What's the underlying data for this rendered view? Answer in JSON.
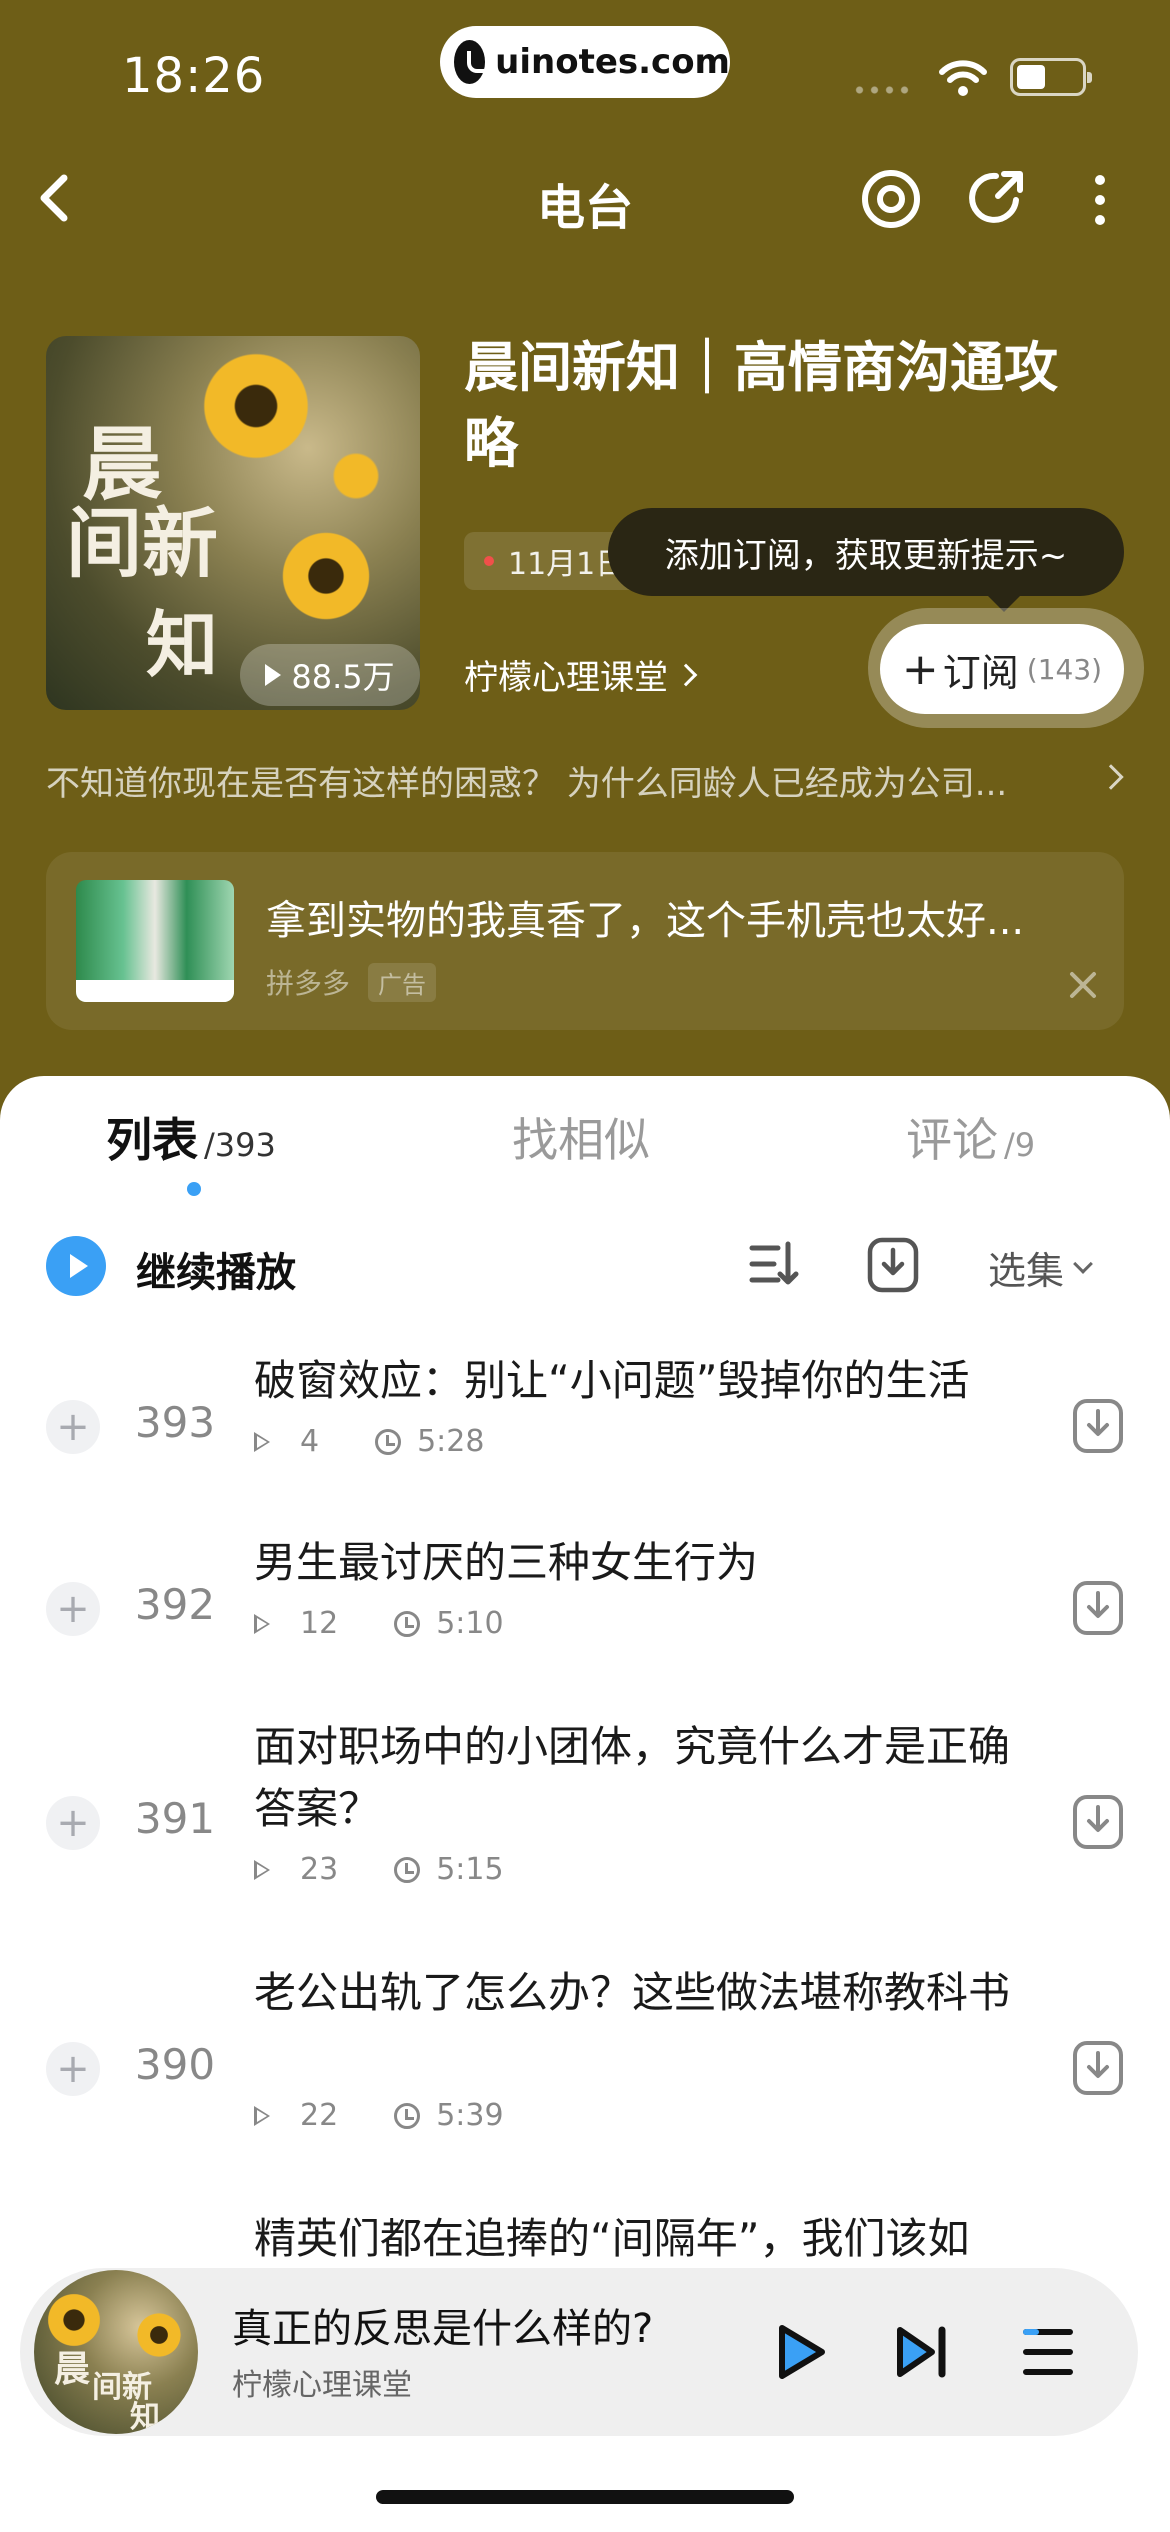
{
  "status_bar": {
    "time": "18:26",
    "url": "uinotes.com"
  },
  "nav": {
    "title": "电台"
  },
  "album": {
    "cover_lines": [
      "晨",
      "间新",
      "知"
    ],
    "plays": "88.5万",
    "title": "晨间新知｜高情商沟通攻略",
    "update": "11月1日更新",
    "tooltip": "添加订阅，获取更新提示~",
    "author": "柠檬心理课堂",
    "subscribe_label": "订阅",
    "subscribe_count": "(143)",
    "description": "不知道你现在是否有这样的困惑？ 为什么同龄人已经成为公司..."
  },
  "ad": {
    "text": "拿到实物的我真香了，这个手机壳也太好...",
    "source": "拼多多",
    "tag": "广告"
  },
  "tabs": [
    {
      "label": "列表",
      "count": "/393"
    },
    {
      "label": "找相似",
      "count": ""
    },
    {
      "label": "评论",
      "count": "/9"
    }
  ],
  "toolbar": {
    "continue_label": "继续播放",
    "select_label": "选集"
  },
  "episodes": [
    {
      "num": "393",
      "title": "破窗效应：别让“小问题”毁掉你的生活",
      "plays": "4",
      "duration": "5:28"
    },
    {
      "num": "392",
      "title": "男生最讨厌的三种女生行为",
      "plays": "12",
      "duration": "5:10"
    },
    {
      "num": "391",
      "title": "面对职场中的小团体，究竟什么才是正确答案？",
      "plays": "23",
      "duration": "5:15"
    },
    {
      "num": "390",
      "title": "老公出轨了怎么办？这些做法堪称教科书",
      "plays": "22",
      "duration": "5:39"
    },
    {
      "num": "",
      "title": "精英们都在追捧的“间隔年”，我们该如",
      "plays": "",
      "duration": ""
    }
  ],
  "player": {
    "title": "真正的反思是什么样的?",
    "author": "柠檬心理课堂"
  },
  "colors": {
    "header_bg": "#6e5e17",
    "accent": "#3aa0f5"
  }
}
